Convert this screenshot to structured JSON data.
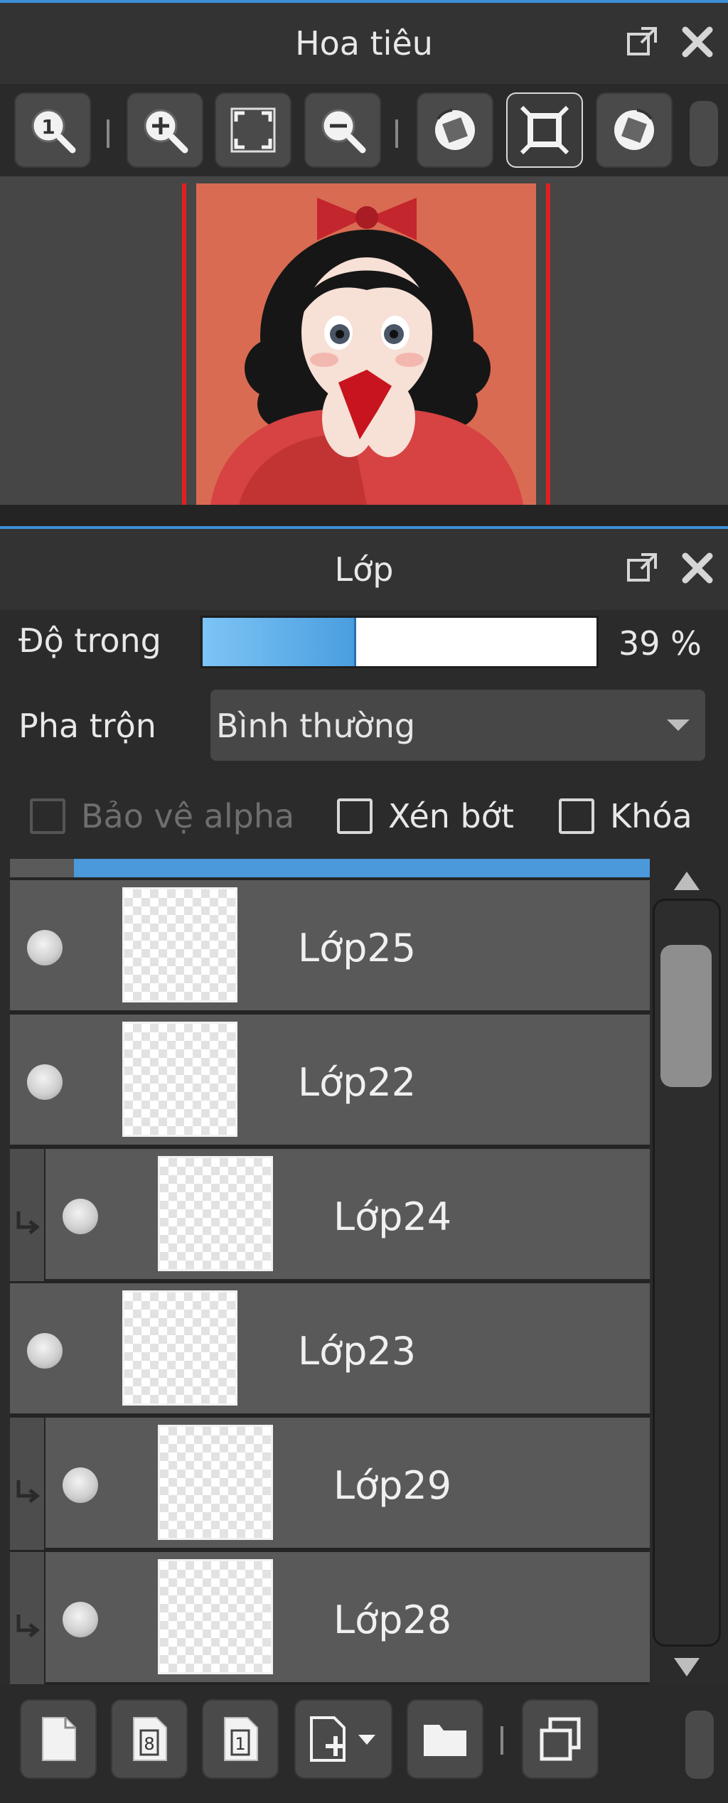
{
  "navigator_panel": {
    "title": "Hoa tiêu",
    "toolbar": {
      "icons": [
        "actual-size-zoom-icon",
        "zoom-in-icon",
        "fit-screen-icon",
        "zoom-out-icon",
        "rotate-left-icon",
        "fit-window-icon",
        "rotate-right-icon"
      ]
    }
  },
  "layer_panel": {
    "title": "Lớp",
    "opacity": {
      "label": "Độ trong",
      "value": 39,
      "display": "39 %"
    },
    "blend": {
      "label": "Pha trộn",
      "value": "Bình thường"
    },
    "options": {
      "protect_alpha": "Bảo vệ alpha",
      "clipping": "Xén bớt",
      "lock": "Khóa"
    },
    "layers": [
      {
        "name": "Lớp25"
      },
      {
        "name": "Lớp22"
      },
      {
        "name": "Lớp24"
      },
      {
        "name": "Lớp23"
      },
      {
        "name": "Lớp29"
      },
      {
        "name": "Lớp28"
      }
    ]
  },
  "colors": {
    "accent": "#4b98db",
    "panel_bg": "#333333",
    "canvas_border": "#e02020"
  }
}
